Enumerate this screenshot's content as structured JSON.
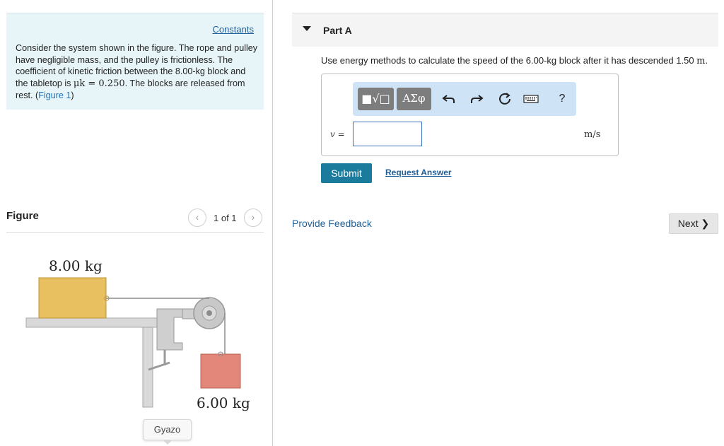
{
  "problem": {
    "constants_link": "Constants",
    "text_part1": "Consider the system shown in the figure. The rope and pulley have negligible mass, and the pulley is frictionless. The coefficient of kinetic friction between the 8.00-kg block and the tabletop is ",
    "mu_symbol": "μk",
    "mu_value": " = 0.250",
    "text_part2": ". The blocks are released from rest. (",
    "figure_link": "Figure 1",
    "text_part3": ")"
  },
  "figure": {
    "title": "Figure",
    "pager_prev": "‹",
    "pager_next": "›",
    "page_count": "1 of 1",
    "mass_top_label": "8.00 kg",
    "mass_hanging_label": "6.00 kg",
    "colors": {
      "block_top": "#e8c060",
      "block_hanging": "#e2877a",
      "table": "#d8d8d8",
      "pulley": "#c8c8c8"
    }
  },
  "gyazo_badge": "Gyazo",
  "part": {
    "title": "Part A",
    "question": "Use energy methods to calculate the speed of the 6.00-kg block after it has descended 1.50 ",
    "question_unit": "m",
    "question_end": "."
  },
  "toolbar": {
    "template_label": "■√□",
    "greek_label": "ΑΣφ",
    "undo_icon": "undo-icon",
    "redo_icon": "redo-icon",
    "reset_icon": "reset-icon",
    "keyboard_icon": "keyboard-icon",
    "help_label": "?"
  },
  "answer": {
    "variable_label": "v =",
    "input_value": "",
    "unit": "m/s"
  },
  "actions": {
    "submit_label": "Submit",
    "request_answer_label": "Request Answer",
    "feedback_label": "Provide Feedback",
    "next_label": "Next ❯"
  }
}
